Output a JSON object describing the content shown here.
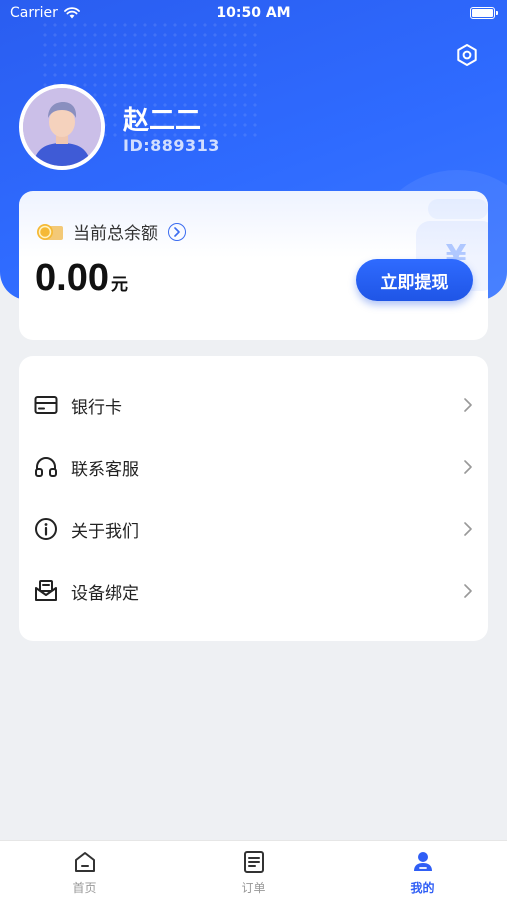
{
  "status_bar": {
    "carrier": "Carrier",
    "time": "10:50 AM"
  },
  "profile": {
    "name": "赵二二",
    "id_label": "ID:889313"
  },
  "balance": {
    "label": "当前总余额",
    "amount": "0.00",
    "unit": "元",
    "withdraw_label": "立即提现"
  },
  "menu": {
    "items": [
      {
        "label": "银行卡",
        "icon": "bank-card-icon"
      },
      {
        "label": "联系客服",
        "icon": "headset-icon"
      },
      {
        "label": "关于我们",
        "icon": "info-icon"
      },
      {
        "label": "设备绑定",
        "icon": "device-envelope-icon"
      }
    ]
  },
  "tab_bar": {
    "tabs": [
      {
        "label": "首页",
        "icon": "home-icon",
        "active": false
      },
      {
        "label": "订单",
        "icon": "order-list-icon",
        "active": false
      },
      {
        "label": "我的",
        "icon": "profile-icon",
        "active": true
      }
    ]
  },
  "colors": {
    "primary": "#2f6bff",
    "header_blue": "#2a5df0",
    "active_tab": "#2f5ef5",
    "background": "#eef0f3"
  }
}
